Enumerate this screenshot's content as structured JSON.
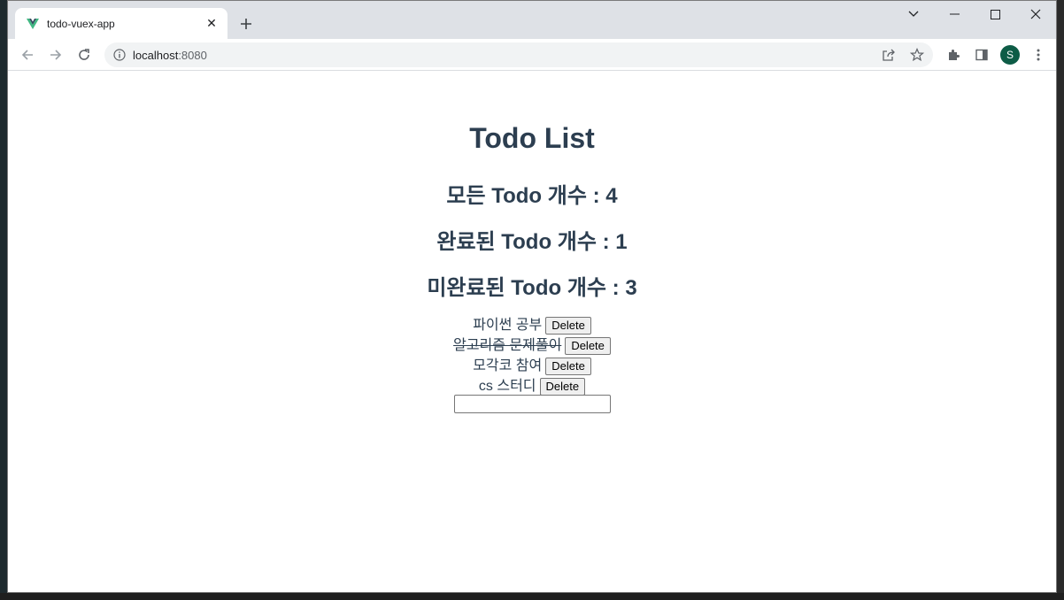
{
  "browser": {
    "tab": {
      "title": "todo-vuex-app",
      "favicon": "vue-logo-icon"
    },
    "address": {
      "host": "localhost",
      "port": ":8080"
    },
    "profile_initial": "S",
    "controls": {
      "minimize": "—",
      "maximize": "☐",
      "close": "✕",
      "tabsearch": "⌄"
    }
  },
  "app": {
    "title": "Todo List",
    "stats": {
      "all": "모든 Todo 개수 : 4",
      "done": "완료된 Todo 개수 : 1",
      "undone": "미완료된 Todo 개수 : 3"
    },
    "todos": [
      {
        "text": "파이썬 공부",
        "completed": false,
        "delete_label": "Delete"
      },
      {
        "text": "알고리즘 문제풀이",
        "completed": true,
        "delete_label": "Delete"
      },
      {
        "text": "모각코 참여",
        "completed": false,
        "delete_label": "Delete"
      },
      {
        "text": "cs 스터디",
        "completed": false,
        "delete_label": "Delete"
      }
    ],
    "new_todo": {
      "value": "",
      "placeholder": ""
    }
  },
  "colors": {
    "text": "#2c3e50",
    "tabstrip": "#dee1e6",
    "omnibox": "#f1f3f4",
    "avatar": "#0d5c46",
    "vue_green": "#41b883",
    "vue_dark": "#35495e"
  }
}
